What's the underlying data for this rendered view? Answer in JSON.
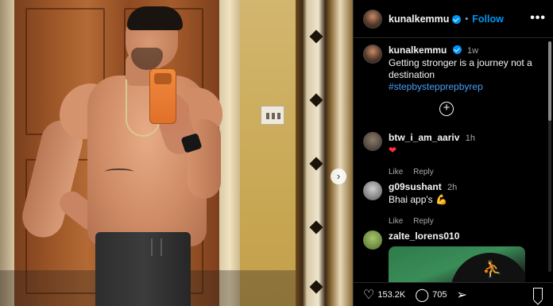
{
  "post": {
    "author": "kunalkemmu",
    "follow_label": "Follow",
    "separator": "•",
    "more_label": "•••",
    "caption": {
      "author": "kunalkemmu",
      "time": "1w",
      "text": "Getting stronger is a journey not a destination",
      "hashtag": "#stepbystepprepbyrep"
    }
  },
  "comments": [
    {
      "author": "btw_i_am_aariv",
      "time": "1h",
      "text": "❤",
      "like_label": "Like",
      "reply_label": "Reply"
    },
    {
      "author": "g09sushant",
      "time": "2h",
      "text": "Bhai app's 💪",
      "like_label": "Like",
      "reply_label": "Reply"
    },
    {
      "author": "zalte_lorens010",
      "time": "",
      "text": ""
    }
  ],
  "actions": {
    "likes": "153.2K",
    "comments": "705"
  },
  "icons": {
    "add_comment": "plus-circle-icon",
    "like": "heart-icon",
    "comment": "comment-icon",
    "share": "send-icon",
    "save": "bookmark-icon",
    "nav": "chevron-right-icon"
  },
  "colors": {
    "accent": "#0095f6",
    "background": "#000000",
    "like": "#ff3040"
  }
}
